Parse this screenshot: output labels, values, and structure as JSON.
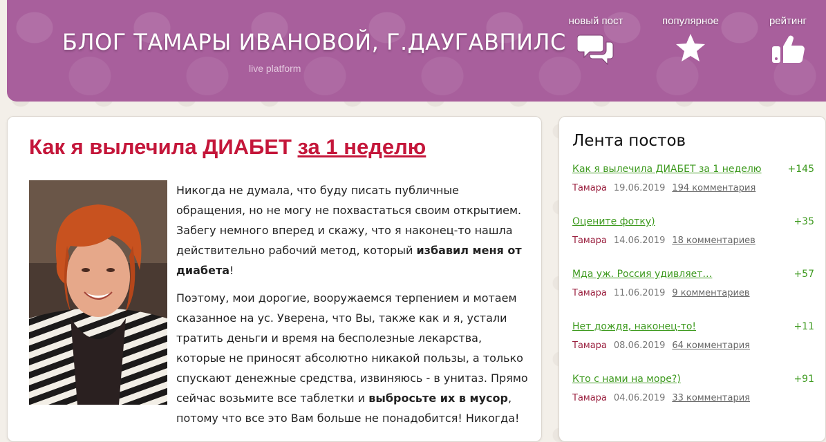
{
  "header": {
    "title": "БЛОГ ТАМАРЫ ИВАНОВОЙ, Г.ДАУГАВПИЛС",
    "subtitle": "live platform",
    "nav": [
      {
        "label": "новый пост",
        "icon": "chat-bubbles-icon"
      },
      {
        "label": "популярное",
        "icon": "star-icon"
      },
      {
        "label": "рейтинг",
        "icon": "thumbs-up-icon"
      }
    ]
  },
  "post": {
    "title_part1": "Как я вылечила ДИАБЕТ ",
    "title_link": "за 1 неделю",
    "p1_a": "Никогда не думала, что буду писать публичные обращения, но не могу не похвастаться своим открытием. Забегу немного вперед и скажу, что я наконец-то нашла действительно рабочий метод, который ",
    "p1_b": "избавил меня от диабета",
    "p1_c": "!",
    "p2_a": "Поэтому, мои дорогие, вооружаемся терпением и мотаем сказанное на ус. Уверена, что Вы, также как и я, устали тратить деньги и время на бесполезные лекарства, которые не приносят абсолютно никакой пользы, а только спускают денежные средства, извиняюсь - в унитаз. Прямо сейчас возьмите все таблетки и ",
    "p2_b": "выбросьте их в мусор",
    "p2_c": ", потому что все это Вам больше не понадобится! Никогда!"
  },
  "sidebar": {
    "title": "Лента постов",
    "items": [
      {
        "title": "Как я вылечила ДИАБЕТ за 1 неделю",
        "score": "+145",
        "author": "Тамара",
        "date": "19.06.2019",
        "comments": "194 комментария"
      },
      {
        "title": "Оцените фотку)",
        "score": "+35",
        "author": "Тамара",
        "date": "14.06.2019",
        "comments": "18 комментариев"
      },
      {
        "title": "Мда уж. Россия удивляет…",
        "score": "+57",
        "author": "Тамара",
        "date": "11.06.2019",
        "comments": "9 комментариев"
      },
      {
        "title": "Нет дождя, наконец-то!",
        "score": "+11",
        "author": "Тамара",
        "date": "08.06.2019",
        "comments": "64 комментария"
      },
      {
        "title": "Кто с нами на море?)",
        "score": "+91",
        "author": "Тамара",
        "date": "04.06.2019",
        "comments": "33 комментария"
      }
    ]
  },
  "colors": {
    "header_bg": "#a85f9c",
    "title_red": "#c4163a",
    "link_green": "#3e9a1f",
    "author_red": "#9a1f3e"
  }
}
